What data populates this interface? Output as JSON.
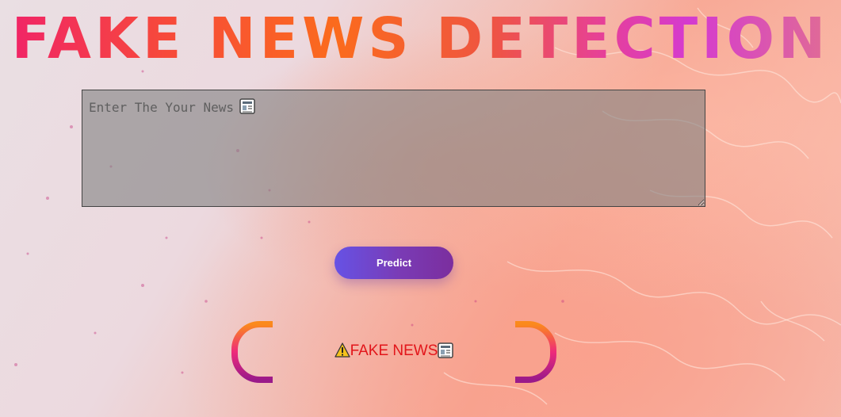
{
  "page": {
    "title": "FAKE NEWS DETECTION"
  },
  "form": {
    "news_placeholder": "Enter The Your News",
    "news_value": "",
    "predict_label": "Predict"
  },
  "result": {
    "text": "FAKE NEWS",
    "prefix_icon": "warning-icon",
    "suffix_icon": "newspaper-icon",
    "color": "#e2151a"
  },
  "colors": {
    "title_gradient": [
      "#f0226a",
      "#fb6b1d",
      "#d43ad0",
      "#e17090"
    ],
    "button_gradient": [
      "#6652e5",
      "#7b2e9e"
    ],
    "bracket_gradient": [
      "#fb8a1c",
      "#ee2a7a",
      "#9a1a8a"
    ]
  }
}
